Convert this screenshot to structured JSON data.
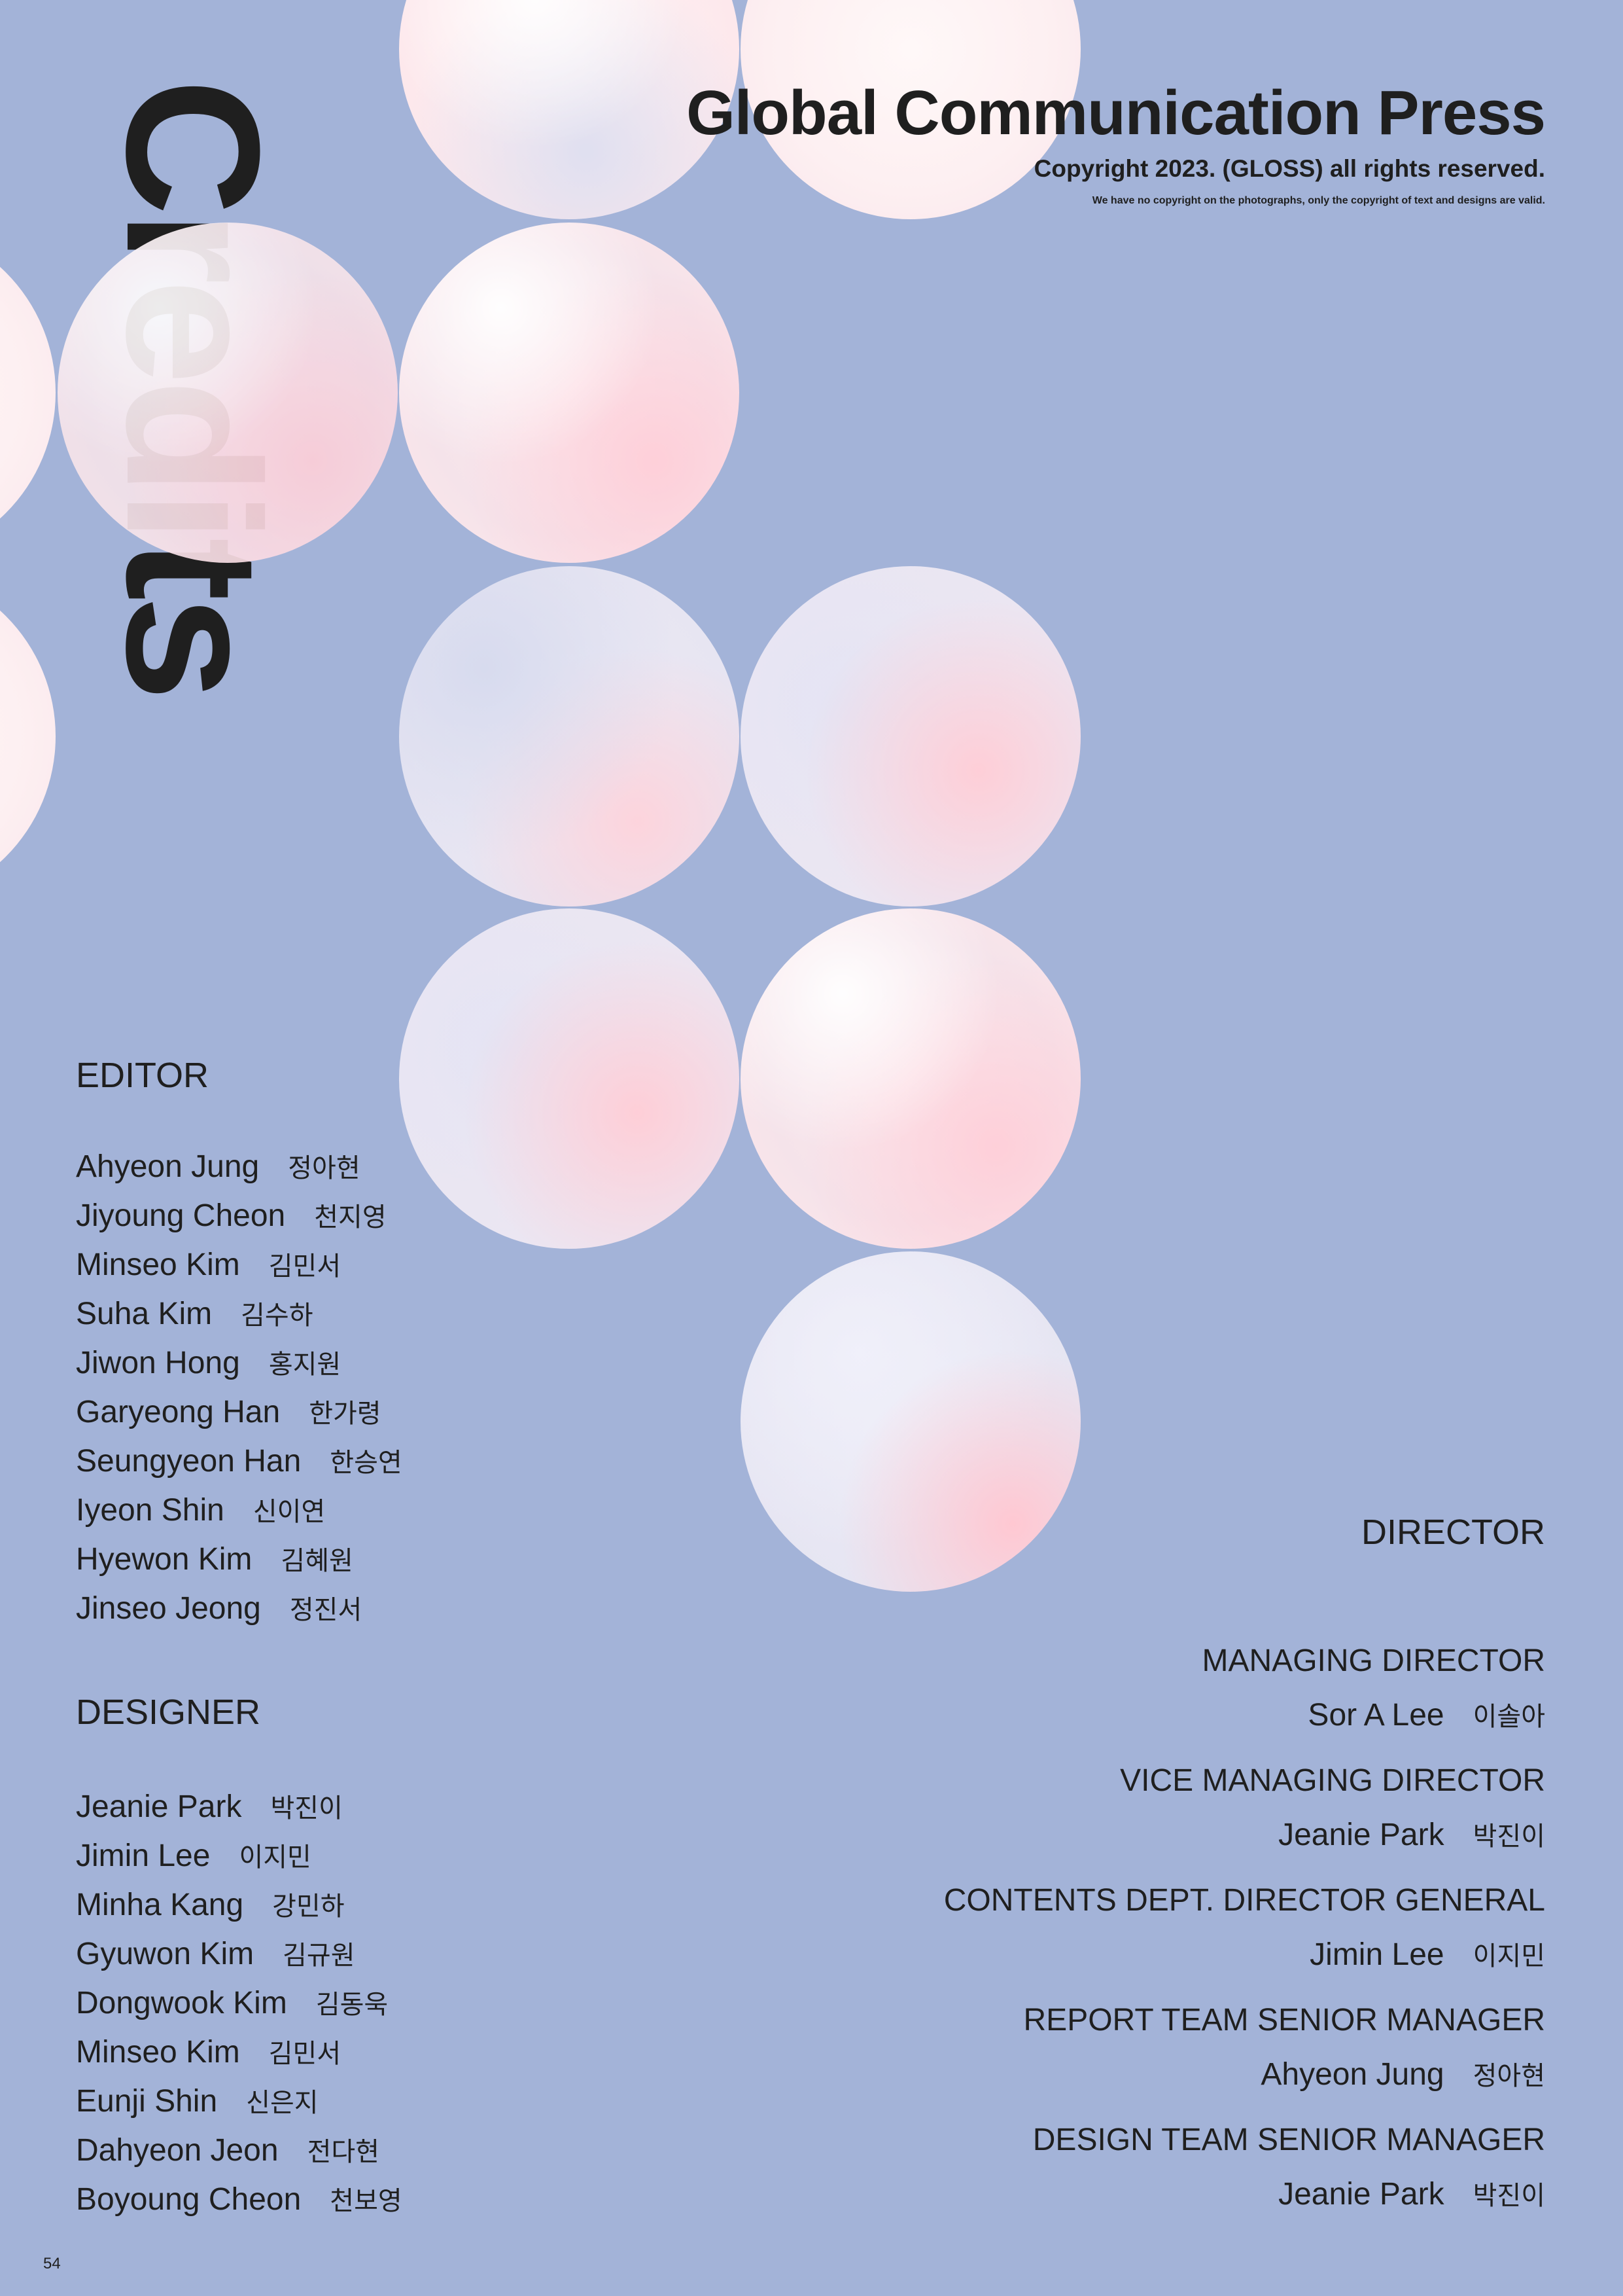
{
  "title_vertical": "Credits",
  "header": {
    "publisher": "Global Communication Press",
    "copyright": "Copyright 2023. (GLOSS) all rights reserved.",
    "disclaimer": "We have no copyright on the photographs, only the copyright of text and designs are valid."
  },
  "editor": {
    "heading": "EDITOR",
    "people": [
      {
        "en": "Ahyeon Jung",
        "ko": "정아현"
      },
      {
        "en": "Jiyoung Cheon",
        "ko": "천지영"
      },
      {
        "en": "Minseo Kim",
        "ko": "김민서"
      },
      {
        "en": "Suha Kim",
        "ko": "김수하"
      },
      {
        "en": "Jiwon Hong",
        "ko": "홍지원"
      },
      {
        "en": "Garyeong Han",
        "ko": "한가령"
      },
      {
        "en": "Seungyeon Han",
        "ko": "한승연"
      },
      {
        "en": "Iyeon Shin",
        "ko": "신이연"
      },
      {
        "en": "Hyewon Kim",
        "ko": "김혜원"
      },
      {
        "en": "Jinseo Jeong",
        "ko": "정진서"
      }
    ]
  },
  "designer": {
    "heading": "DESIGNER",
    "people": [
      {
        "en": "Jeanie Park",
        "ko": "박진이"
      },
      {
        "en": "Jimin Lee",
        "ko": "이지민"
      },
      {
        "en": "Minha Kang",
        "ko": "강민하"
      },
      {
        "en": "Gyuwon Kim",
        "ko": "김규원"
      },
      {
        "en": "Dongwook Kim",
        "ko": "김동욱"
      },
      {
        "en": "Minseo Kim",
        "ko": "김민서"
      },
      {
        "en": "Eunji Shin",
        "ko": "신은지"
      },
      {
        "en": "Dahyeon Jeon",
        "ko": "전다현"
      },
      {
        "en": "Boyoung Cheon",
        "ko": "천보영"
      }
    ]
  },
  "director": {
    "heading": "DIRECTOR",
    "roles": [
      {
        "role": "MANAGING DIRECTOR",
        "en": "Sor A Lee",
        "ko": "이솔아"
      },
      {
        "role": "VICE MANAGING DIRECTOR",
        "en": "Jeanie Park",
        "ko": "박진이"
      },
      {
        "role": "CONTENTS DEPT. DIRECTOR GENERAL",
        "en": "Jimin Lee",
        "ko": "이지민"
      },
      {
        "role": "REPORT TEAM SENIOR MANAGER",
        "en": "Ahyeon Jung",
        "ko": "정아현"
      },
      {
        "role": "DESIGN TEAM SENIOR MANAGER",
        "en": "Jeanie Park",
        "ko": "박진이"
      }
    ]
  },
  "page_number": "54",
  "colors": {
    "background": "#a3b3d8",
    "text": "#1f1f1f",
    "orb_pink": "#ffd0d8",
    "orb_lavender": "#e6e4f2"
  }
}
